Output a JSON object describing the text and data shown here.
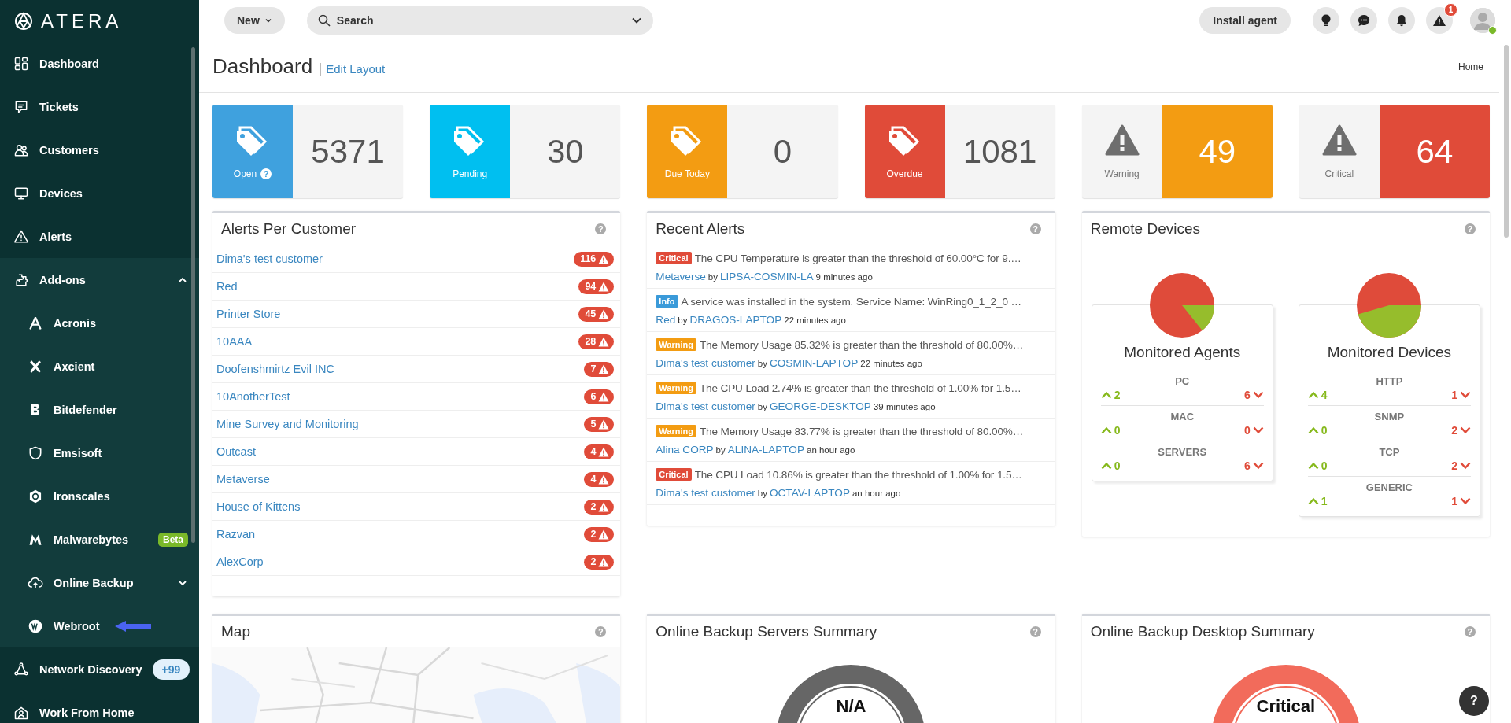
{
  "sidebar": {
    "logo": "ATERA",
    "items": [
      {
        "label": "Dashboard"
      },
      {
        "label": "Tickets"
      },
      {
        "label": "Customers"
      },
      {
        "label": "Devices"
      },
      {
        "label": "Alerts"
      },
      {
        "label": "Add-ons",
        "expanded": true,
        "children": [
          {
            "label": "Acronis"
          },
          {
            "label": "Axcient"
          },
          {
            "label": "Bitdefender"
          },
          {
            "label": "Emsisoft"
          },
          {
            "label": "Ironscales"
          },
          {
            "label": "Malwarebytes",
            "badge": {
              "text": "Beta",
              "color": "#7ab929"
            }
          },
          {
            "label": "Online Backup",
            "expanded": false
          },
          {
            "label": "Webroot",
            "pointer_arrow": true
          }
        ]
      },
      {
        "label": "Network Discovery",
        "badge": {
          "text": "+99",
          "color": "#e3f1fb"
        }
      },
      {
        "label": "Work From Home"
      }
    ]
  },
  "topbar": {
    "new_button": "New",
    "search": {
      "placeholder": "Search"
    },
    "install_button": "Install agent",
    "alert_badge": "1",
    "user_online": true
  },
  "header": {
    "title": "Dashboard",
    "edit_link": "Edit Layout",
    "breadcrumb": "Home"
  },
  "tiles": [
    {
      "kind": "ticket",
      "label": "Open",
      "value": "5371",
      "color": "#3fa1de",
      "help": "?"
    },
    {
      "kind": "ticket",
      "label": "Pending",
      "value": "30",
      "color": "#00bff0"
    },
    {
      "kind": "ticket",
      "label": "Due Today",
      "value": "0",
      "color": "#f39c12"
    },
    {
      "kind": "ticket",
      "label": "Overdue",
      "value": "1081",
      "color": "#e04b39"
    },
    {
      "kind": "alert",
      "label": "Warning",
      "value": "49",
      "color": "#f39c12"
    },
    {
      "kind": "alert",
      "label": "Critical",
      "value": "64",
      "color": "#e04b39"
    }
  ],
  "alerts_per_customer": {
    "title": "Alerts Per Customer",
    "help": "?",
    "rows": [
      {
        "customer": "Dima's test customer",
        "count": "116"
      },
      {
        "customer": "Red",
        "count": "94"
      },
      {
        "customer": "Printer Store",
        "count": "45"
      },
      {
        "customer": "10AAA",
        "count": "28"
      },
      {
        "customer": "Doofenshmirtz Evil INC",
        "count": "7"
      },
      {
        "customer": "10AnotherTest",
        "count": "6"
      },
      {
        "customer": "Mine Survey and Monitoring",
        "count": "5"
      },
      {
        "customer": "Outcast",
        "count": "4"
      },
      {
        "customer": "Metaverse",
        "count": "4"
      },
      {
        "customer": "House of Kittens",
        "count": "2"
      },
      {
        "customer": "Razvan",
        "count": "2"
      },
      {
        "customer": "AlexCorp",
        "count": "2"
      }
    ]
  },
  "recent_alerts": {
    "title": "Recent Alerts",
    "help": "?",
    "alerts": [
      {
        "kind": "critical",
        "badge": "Critical",
        "message": "The CPU Temperature is greater than the threshold of 60.00°C for 9.…",
        "customer": "Metaverse",
        "by": "by",
        "device": "LIPSA-COSMIN-LA",
        "time": "9 minutes ago"
      },
      {
        "kind": "info",
        "badge": "Info",
        "message": "A service was installed in the system. Service Name: WinRing0_1_2_0 …",
        "customer": "Red",
        "by": "by",
        "device": "DRAGOS-LAPTOP",
        "time": "22 minutes ago"
      },
      {
        "kind": "warning",
        "badge": "Warning",
        "message": "The Memory Usage 85.32% is greater than the threshold of 80.00%…",
        "customer": "Dima's test customer",
        "by": "by",
        "device": "COSMIN-LAPTOP",
        "time": "22 minutes ago"
      },
      {
        "kind": "warning",
        "badge": "Warning",
        "message": "The CPU Load 2.74% is greater than the threshold of 1.00% for 1.5…",
        "customer": "Dima's test customer",
        "by": "by",
        "device": "GEORGE-DESKTOP",
        "time": "39 minutes ago"
      },
      {
        "kind": "warning",
        "badge": "Warning",
        "message": "The Memory Usage 83.77% is greater than the threshold of 80.00%…",
        "customer": "Alina CORP",
        "by": "by",
        "device": "ALINA-LAPTOP",
        "time": "an hour ago"
      },
      {
        "kind": "critical",
        "badge": "Critical",
        "message": "The CPU Load 10.86% is greater than the threshold of 1.00% for 1.5…",
        "customer": "Dima's test customer",
        "by": "by",
        "device": "OCTAV-LAPTOP",
        "time": "an hour ago"
      }
    ]
  },
  "remote_devices": {
    "title": "Remote Devices",
    "help": "?",
    "groups": [
      {
        "title": "Monitored Agents",
        "rows": [
          {
            "category": "PC",
            "up": "2",
            "down": "6"
          },
          {
            "category": "MAC",
            "up": "0",
            "down": "0"
          },
          {
            "category": "SERVERS",
            "up": "0",
            "down": "6"
          }
        ]
      },
      {
        "title": "Monitored Devices",
        "rows": [
          {
            "category": "HTTP",
            "up": "4",
            "down": "1"
          },
          {
            "category": "SNMP",
            "up": "0",
            "down": "2"
          },
          {
            "category": "TCP",
            "up": "0",
            "down": "2"
          },
          {
            "category": "GENERIC",
            "up": "1",
            "down": "1"
          }
        ]
      }
    ]
  },
  "map": {
    "title": "Map",
    "help": "?",
    "kind": "picture"
  },
  "backup_servers": {
    "title": "Online Backup Servers Summary",
    "help": "?",
    "kind": "unknown",
    "status": "N/A"
  },
  "backup_desktop": {
    "title": "Online Backup Desktop Summary",
    "help": "?",
    "kind": "critical",
    "status": "Critical"
  },
  "help_button": "?"
}
